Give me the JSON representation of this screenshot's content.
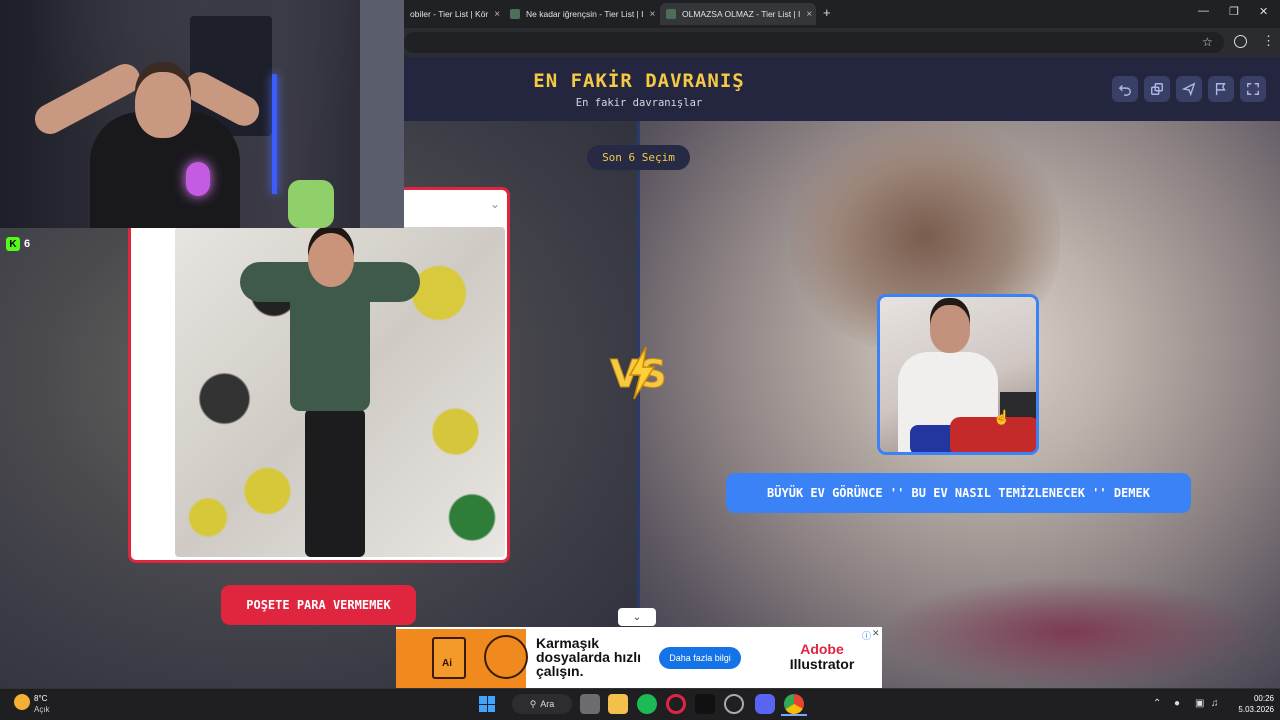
{
  "browser": {
    "tabs": [
      {
        "label": "obiler - Tier List | Kör"
      },
      {
        "label": "Ne kadar iğrençsin - Tier List | I"
      },
      {
        "label": "OLMAZSA OLMAZ - Tier List | I"
      }
    ],
    "new_tab_label": "+",
    "close_tab_label": "×"
  },
  "header": {
    "title": "EN FAKİR DAVRANIŞ",
    "subtitle": "En fakir davranışlar"
  },
  "toolbar_icons": [
    "undo-icon",
    "share-icon",
    "send-icon",
    "flag-icon",
    "fullscreen-icon"
  ],
  "son_secim": "Son 6 Seçim",
  "left_choice": {
    "label": "POŞETE PARA VERMEMEK"
  },
  "right_choice": {
    "label": "BÜYÜK EV GÖRÜNCE '' BU EV NASIL TEMİZLENECEK '' DEMEK"
  },
  "vs_text": "VS",
  "stream": {
    "viewer_count": "6",
    "platform_glyph": "K"
  },
  "ad": {
    "headline": "Karmaşık dosyalarda hızlı çalışın.",
    "cta": "Daha fazla bilgi",
    "brand_line1": "Adobe",
    "brand_line2": "Illustrator",
    "ai_glyph": "Ai"
  },
  "taskbar": {
    "weather_temp": "8°C",
    "weather_desc": "Açık",
    "search_label": "Ara",
    "time": "00:26",
    "date": "5.03.2026"
  },
  "colors": {
    "accent_yellow": "#f6c945",
    "left_red": "#e0253f",
    "right_blue": "#3b82f6",
    "header_bg": "#242640"
  }
}
